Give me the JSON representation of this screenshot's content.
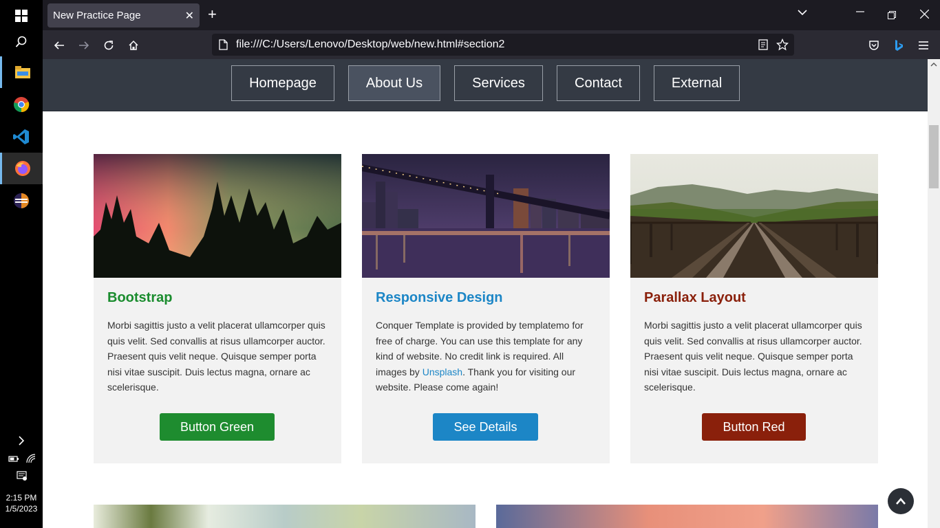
{
  "taskbar": {
    "time": "2:15 PM",
    "date": "1/5/2023"
  },
  "browser": {
    "tab_title": "New Practice Page",
    "url": "file:///C:/Users/Lenovo/Desktop/web/new.html#section2"
  },
  "site": {
    "nav": [
      {
        "label": "Homepage",
        "active": false
      },
      {
        "label": "About Us",
        "active": true
      },
      {
        "label": "Services",
        "active": false
      },
      {
        "label": "Contact",
        "active": false
      },
      {
        "label": "External",
        "active": false
      }
    ],
    "cards": [
      {
        "title": "Bootstrap",
        "title_color": "#1a8c2e",
        "body": "Morbi sagittis justo a velit placerat ullamcorper quis quis velit. Sed convallis at risus ullamcorper auctor. Praesent quis velit neque. Quisque semper porta nisi vitae suscipit. Duis lectus magna, ornare ac scelerisque.",
        "button": "Button Green",
        "button_color": "#1e8c2f"
      },
      {
        "title": "Responsive Design",
        "title_color": "#1c86c6",
        "body_before_link": "Conquer Template is provided by templatemo for free of charge. You can use this template for any kind of website. No credit link is required. All images by ",
        "link_text": "Unsplash",
        "body_after_link": ". Thank you for visiting our website. Please come again!",
        "button": "See Details",
        "button_color": "#1c86c6"
      },
      {
        "title": "Parallax Layout",
        "title_color": "#8a200b",
        "body": "Morbi sagittis justo a velit placerat ullamcorper quis quis velit. Sed convallis at risus ullamcorper auctor. Praesent quis velit neque. Quisque semper porta nisi vitae suscipit. Duis lectus magna, ornare ac scelerisque.",
        "button": "Button Red",
        "button_color": "#8a200b"
      }
    ]
  }
}
